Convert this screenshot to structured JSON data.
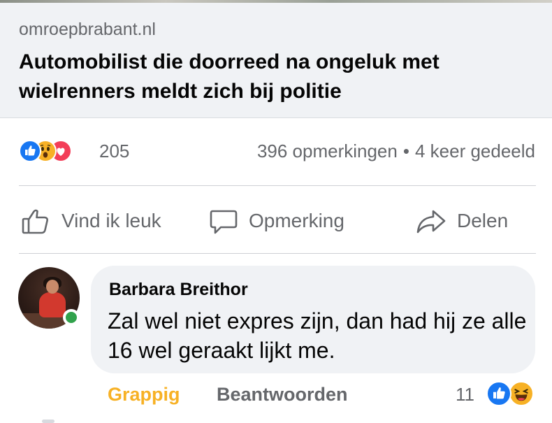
{
  "link_preview": {
    "domain": "omroepbrabant.nl",
    "title": "Automobilist die doorreed na ongeluk met wielrenners meldt zich bij politie"
  },
  "stats": {
    "reaction_icons": [
      "like-icon",
      "wow-icon",
      "love-icon"
    ],
    "reaction_count": "205",
    "comments": "396 opmerkingen",
    "separator": "•",
    "shares": "4 keer gedeeld"
  },
  "actions": {
    "like": "Vind ik leuk",
    "comment": "Opmerking",
    "share": "Delen"
  },
  "comment": {
    "author": "Barbara Breithor",
    "text": "Zal wel niet expres zijn, dan had hij ze alle 16 wel geraakt lijkt me.",
    "reaction_label": "Grappig",
    "reply_label": "Beantwoorden",
    "reaction_count": "11",
    "reaction_icons": [
      "like-icon",
      "haha-icon"
    ]
  },
  "colors": {
    "facebook_blue": "#1877f2",
    "haha_yellow": "#f7b125",
    "love_red": "#f33e58",
    "online_green": "#31a24c",
    "secondary_text": "#65676b",
    "bubble_bg": "#f0f2f5"
  }
}
